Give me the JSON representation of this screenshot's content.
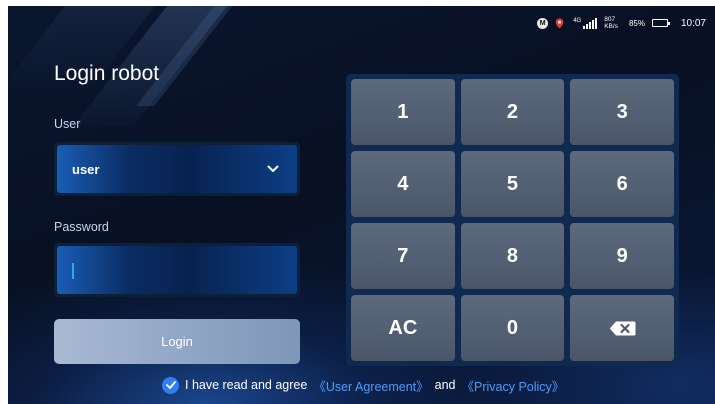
{
  "status_bar": {
    "m_badge": "M",
    "net_type": "4G",
    "net_speed_value": "807",
    "net_speed_unit": "KB/s",
    "battery": "85%",
    "battery_level": 0.85,
    "time": "10:07"
  },
  "login": {
    "title": "Login robot",
    "user_label": "User",
    "user_value": "user",
    "password_label": "Password",
    "password_value": "",
    "button_label": "Login"
  },
  "keypad": {
    "keys": [
      "1",
      "2",
      "3",
      "4",
      "5",
      "6",
      "7",
      "8",
      "9",
      "AC",
      "0",
      "backspace-icon"
    ]
  },
  "agreement": {
    "checked": true,
    "text": "I have read and agree",
    "user_agreement": "《User Agreement》",
    "and": "and",
    "privacy_policy": "《Privacy Policy》"
  },
  "colors": {
    "accent": "#2f7ff0",
    "link": "#4d9bff",
    "login_button": "#97aac8",
    "key": "#56627a",
    "location_pin": "#e53935"
  }
}
